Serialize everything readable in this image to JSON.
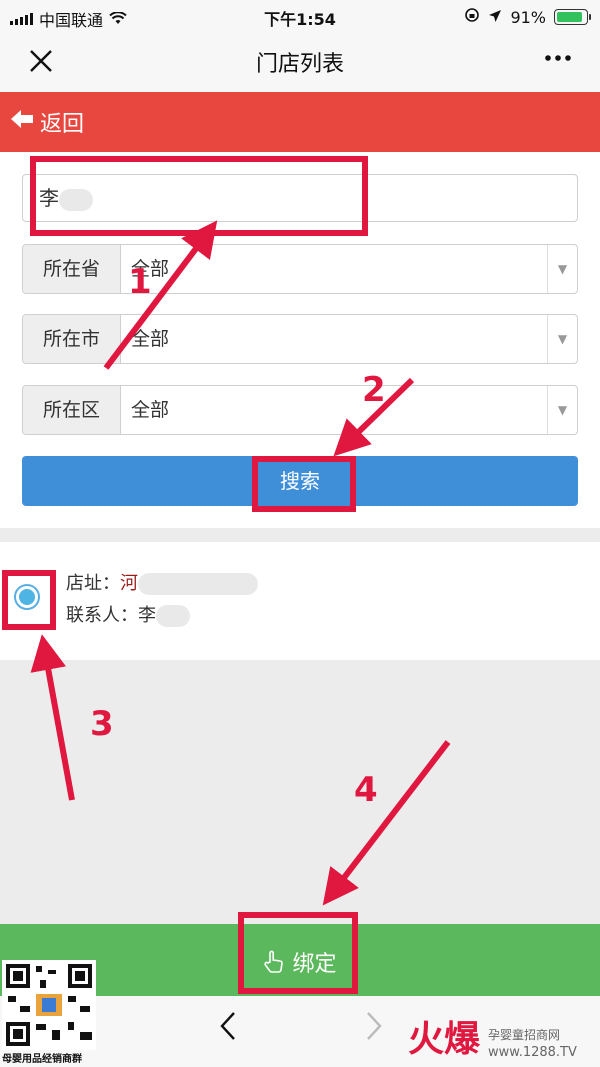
{
  "status_bar": {
    "carrier": "中国联通",
    "time": "下午1:54",
    "battery": "91%",
    "battery_level": 0.91
  },
  "nav": {
    "title": "门店列表",
    "close_icon": "close-icon",
    "more_icon": "more-icon"
  },
  "backbar": {
    "label": "返回"
  },
  "search": {
    "value": "李"
  },
  "filters": [
    {
      "label": "所在省",
      "value": "全部"
    },
    {
      "label": "所在市",
      "value": "全部"
    },
    {
      "label": "所在区",
      "value": "全部"
    }
  ],
  "search_button": {
    "label": "搜索"
  },
  "store": {
    "addr_label": "店址：",
    "addr_value": "河",
    "contact_label": "联系人：",
    "contact_value": "李",
    "selected": true
  },
  "bind_button": {
    "label": "绑定"
  },
  "annotations": [
    "1",
    "2",
    "3",
    "4"
  ],
  "watermark": {
    "qr_caption": "母婴用品经销商群",
    "brand": "火爆",
    "site": "孕婴童招商网",
    "url": "www.1288.TV"
  },
  "colors": {
    "header_red": "#e8473f",
    "search_blue": "#3f8ed8",
    "bind_green": "#5cb85c",
    "annotation_red": "#e0173f"
  }
}
